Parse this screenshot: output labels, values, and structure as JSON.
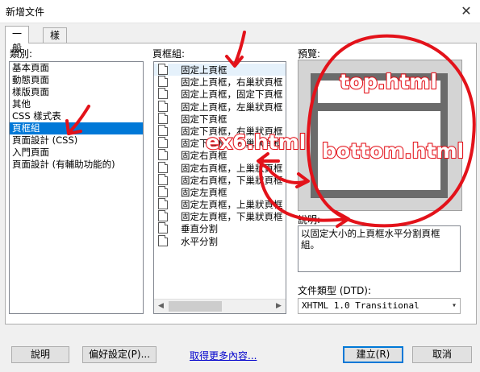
{
  "window": {
    "title": "新增文件",
    "close_glyph": "✕"
  },
  "tabs": [
    {
      "label": "一般",
      "active": true
    },
    {
      "label": "樣版",
      "active": false
    }
  ],
  "category": {
    "label": "類別:",
    "items": [
      "基本頁面",
      "動態頁面",
      "樣版頁面",
      "其他",
      "CSS 樣式表",
      "頁框組",
      "頁面設計 (CSS)",
      "入門頁面",
      "頁面設計 (有輔助功能的)"
    ],
    "selected_index": 5
  },
  "frameset": {
    "label": "頁框組:",
    "items": [
      "固定上頁框",
      "固定上頁框，右巢狀頁框",
      "固定上頁框，固定下頁框",
      "固定上頁框，左巢狀頁框",
      "固定下頁框",
      "固定下頁框，右巢狀頁框",
      "固定下頁框，左巢狀頁框",
      "固定右頁框",
      "固定右頁框，上巢狀頁框",
      "固定右頁框，下巢狀頁框",
      "固定左頁框",
      "固定左頁框，上巢狀頁框",
      "固定左頁框，下巢狀頁框",
      "垂直分割",
      "水平分割"
    ],
    "selected_index": 0
  },
  "preview": {
    "label": "預覽:"
  },
  "description": {
    "label": "說明:",
    "text": "以固定大小的上頁框水平分割頁框組。"
  },
  "doctype": {
    "label": "文件類型 (DTD):",
    "value": "XHTML 1.0 Transitional"
  },
  "buttons": {
    "help": "說明",
    "prefs": "偏好設定(P)...",
    "more": "取得更多內容...",
    "create": "建立(R)",
    "cancel": "取消"
  },
  "annotations": {
    "top": "top.html",
    "bottom": "bottom.html",
    "ex6": "ex6.html",
    "color": "#e3121a"
  }
}
